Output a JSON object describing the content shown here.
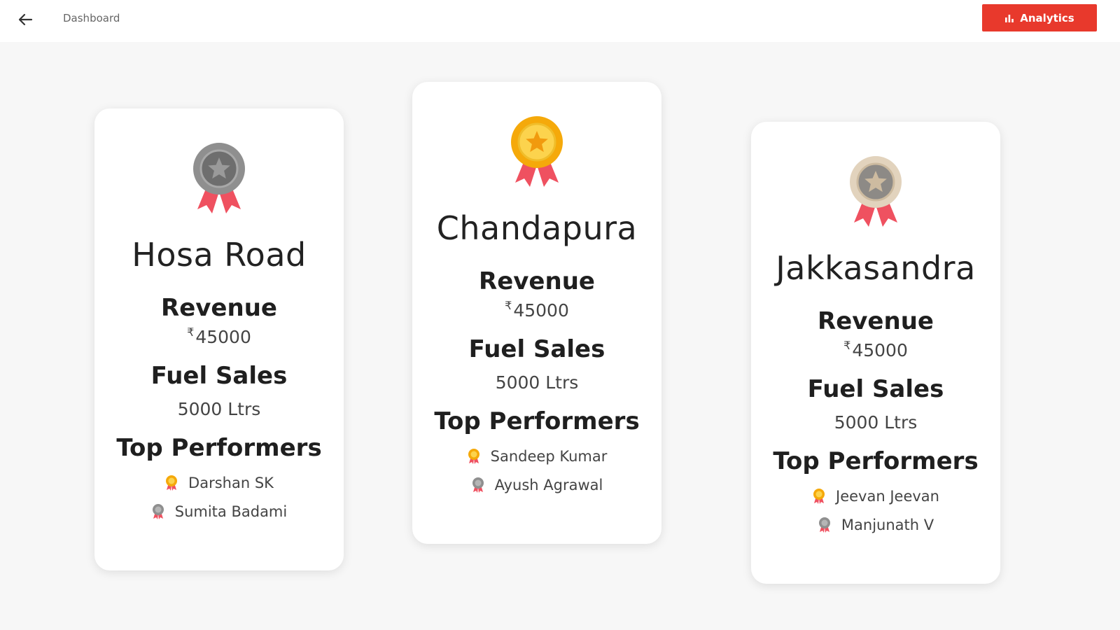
{
  "header": {
    "title": "Dashboard",
    "analytics_label": "Analytics"
  },
  "colors": {
    "accent": "#e8392c",
    "gold": "#f5a90a",
    "silver": "#8f8f8f",
    "bronze": "#e2d3bd",
    "ribbon": "#ef5160"
  },
  "cards": [
    {
      "name": "Hosa Road",
      "medal": "silver-medal-icon",
      "revenue_label": "Revenue",
      "currency": "₹",
      "revenue_value": "45000",
      "fuel_label": "Fuel Sales",
      "fuel_value": "5000 Ltrs",
      "performers_label": "Top Performers",
      "performers": [
        "Darshan SK",
        "Sumita Badami"
      ]
    },
    {
      "name": "Chandapura",
      "medal": "gold-medal-icon",
      "revenue_label": "Revenue",
      "currency": "₹",
      "revenue_value": "45000",
      "fuel_label": "Fuel Sales",
      "fuel_value": "5000 Ltrs",
      "performers_label": "Top Performers",
      "performers": [
        "Sandeep Kumar",
        "Ayush Agrawal"
      ]
    },
    {
      "name": "Jakkasandra",
      "medal": "bronze-medal-icon",
      "revenue_label": "Revenue",
      "currency": "₹",
      "revenue_value": "45000",
      "fuel_label": "Fuel Sales",
      "fuel_value": "5000 Ltrs",
      "performers_label": "Top Performers",
      "performers": [
        "Jeevan Jeevan",
        "Manjunath V"
      ]
    }
  ]
}
